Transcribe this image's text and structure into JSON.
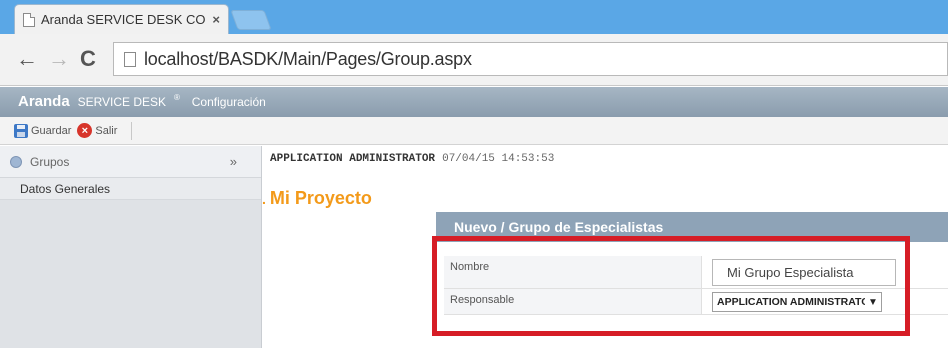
{
  "browser": {
    "tab_title": "Aranda SERVICE DESK CO",
    "tab_close": "×",
    "nav_back": "←",
    "nav_forward": "→",
    "nav_reload": "C",
    "url": "localhost/BASDK/Main/Pages/Group.aspx"
  },
  "app_header": {
    "brand_main": "Aranda",
    "brand_sub": "SERVICE DESK",
    "brand_sep": "®",
    "section": "Configuración"
  },
  "toolbar": {
    "save_label": "Guardar",
    "exit_label": "Salir",
    "exit_glyph": "×"
  },
  "sidebar": {
    "group_title": "Grupos",
    "collapse_glyph": "»",
    "items": [
      {
        "label": "Datos Generales"
      }
    ]
  },
  "main": {
    "user": "APPLICATION ADMINISTRATOR",
    "timestamp": "07/04/15 14:53:53",
    "project_title": "Mi Proyecto",
    "panel": {
      "title": "Nuevo / Grupo de Especialistas",
      "fields": [
        {
          "label": "Nombre",
          "value": "Mi Grupo Especialista"
        },
        {
          "label": "Responsable",
          "value": "APPLICATION ADMINISTRATOR"
        }
      ],
      "select_caret": "▼"
    }
  },
  "colors": {
    "accent_orange": "#f39a1a",
    "highlight_red": "#d61d26",
    "panel_header": "#8ea3b7",
    "tabstrip_blue": "#5aa7e6"
  }
}
